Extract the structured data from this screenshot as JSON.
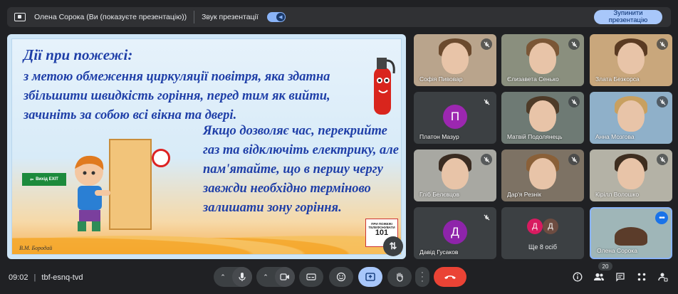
{
  "top_bar": {
    "presenter_text": "Олена Сорока (Ви (показуєте презентацію))",
    "sound_label": "Звук презентації",
    "stop_button": "Зупинити\nпрезентацію"
  },
  "slide": {
    "title": "Дії при пожежі:",
    "paragraph1": "з метою обмеження циркуляції повітря, яка здатна збільшити швидкість горіння, перед тим як вийти, зачиніть за собою всі вікна та двері.",
    "paragraph2": "Якщо дозволяє час, перекрийте газ та відключіть електрику, але пам'ятайте, що в першу чергу завжди необхідно терміново залишати зону горіння.",
    "author": "В.М. Бородай",
    "exit_sign": "Вихід EXIT",
    "phone_sign_text": "ПРИ ПОЖЕЖІ ТЕЛЕФОНУВАТИ",
    "phone_sign_number": "101"
  },
  "participants": [
    {
      "name": "Софія Пивовар",
      "muted": true
    },
    {
      "name": "Єлизавета Сенько",
      "muted": true
    },
    {
      "name": "Злата Безкорса",
      "muted": true
    },
    {
      "name": "Платон Мазур",
      "muted": true,
      "initial": "П",
      "avatar_color": "#9c27b0"
    },
    {
      "name": "Матвій Подолянець",
      "muted": true
    },
    {
      "name": "Анна Мозгова",
      "muted": true
    },
    {
      "name": "Гліб Белєвцов",
      "muted": true
    },
    {
      "name": "Дар'я Резнік",
      "muted": true
    },
    {
      "name": "Кірілл Волошко",
      "muted": true
    },
    {
      "name": "Давід Гусаков",
      "muted": true,
      "initial": "Д",
      "avatar_color": "#8e24aa"
    },
    {
      "name": "Ще 8 осіб",
      "initials": [
        "Д",
        "Д"
      ]
    },
    {
      "name": "Олена Сорока",
      "self": true
    }
  ],
  "bottom_bar": {
    "time": "09:02",
    "meeting_code": "tbf-esnq-tvd",
    "participant_count": "20"
  },
  "colors": {
    "background": "#202124",
    "tile": "#3c4043",
    "accent": "#8ab4f8",
    "end_call": "#ea4335"
  }
}
